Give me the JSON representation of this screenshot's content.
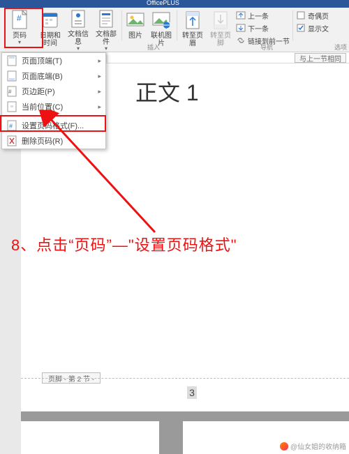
{
  "titlebar": {
    "product": "OfficePLUS"
  },
  "ribbon": {
    "groups": {
      "insert_label": "插入",
      "nav_label": "导航",
      "select_label": "选项"
    },
    "buttons": {
      "page_number": {
        "label": "页码"
      },
      "date_time": {
        "label": "日期和时间"
      },
      "doc_info": {
        "label": "文档信息"
      },
      "doc_parts": {
        "label": "文档部件"
      },
      "picture": {
        "label": "图片"
      },
      "online_pic": {
        "label": "联机图片"
      },
      "goto_header": {
        "label": "转至页眉"
      },
      "goto_footer": {
        "label": "转至页脚"
      }
    },
    "side": {
      "prev_section": "上一条",
      "next_section": "下一条",
      "link_prev": "链接到前一节",
      "diff_odd_even": "奇偶页",
      "show_doc": "显示文"
    }
  },
  "dropdown": {
    "items": [
      {
        "label": "页面顶端(T)",
        "has_sub": true
      },
      {
        "label": "页面底端(B)",
        "has_sub": true
      },
      {
        "label": "页边距(P)",
        "has_sub": true
      },
      {
        "label": "当前位置(C)",
        "has_sub": true
      },
      {
        "label": "设置页码格式(F)...",
        "has_sub": false
      },
      {
        "label": "删除页码(R)",
        "has_sub": false
      }
    ]
  },
  "document": {
    "header_text": "正文 1",
    "same_as_prev_tag": "与上一节相同",
    "footer_tag": "页脚 - 第 2 节 -",
    "footer_page_number": "3"
  },
  "annotation": {
    "instruction": "8、点击“页码”—\"设置页码格式\""
  },
  "watermark": {
    "text": "@仙女姐的收纳箱"
  }
}
